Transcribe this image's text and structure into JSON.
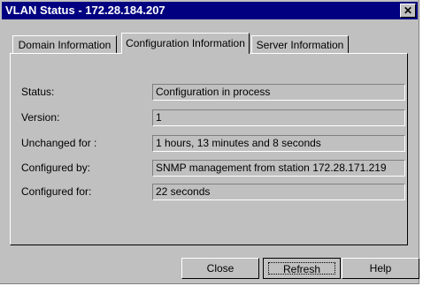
{
  "window": {
    "title": "VLAN Status - 172.28.184.207",
    "close_glyph": "✕"
  },
  "tabs": [
    {
      "label": "Domain Information"
    },
    {
      "label": "Configuration Information"
    },
    {
      "label": "Server Information"
    }
  ],
  "fields": [
    {
      "label": "Status:",
      "value": "Configuration in process"
    },
    {
      "label": "Version:",
      "value": "1"
    },
    {
      "label": "Unchanged for :",
      "value": "1 hours, 13 minutes and  8 seconds"
    },
    {
      "label": "Configured by:",
      "value": "SNMP management from station 172.28.171.219"
    },
    {
      "label": "Configured for:",
      "value": "22 seconds"
    }
  ],
  "buttons": {
    "close": "Close",
    "refresh": "Refresh",
    "help": "Help"
  }
}
